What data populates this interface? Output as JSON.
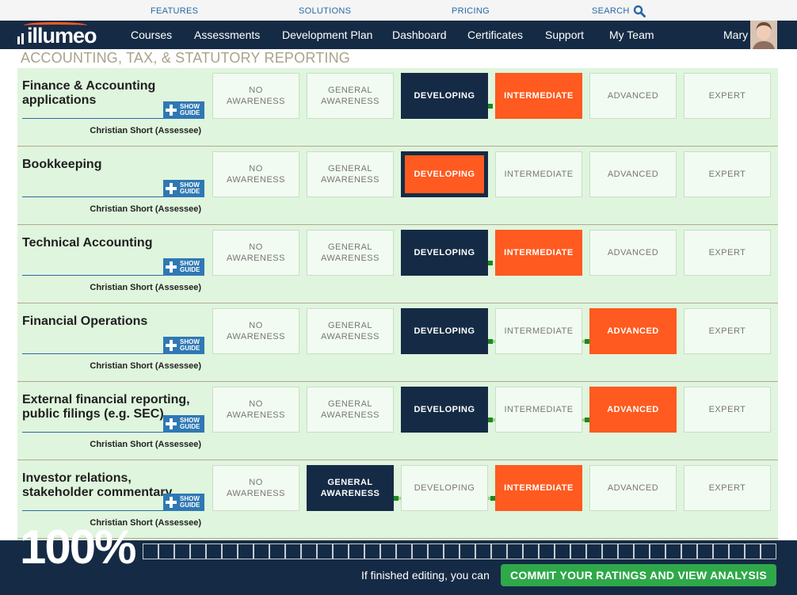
{
  "top_links": {
    "features": "FEATURES",
    "solutions": "SOLUTIONS",
    "pricing": "PRICING",
    "search": "SEARCH"
  },
  "nav": {
    "logo": "illumeo",
    "items": [
      "Courses",
      "Assessments",
      "Development Plan",
      "Dashboard",
      "Certificates",
      "Support",
      "My Team"
    ],
    "user": "Mary"
  },
  "section_title": "ACCOUNTING, TAX, & STATUTORY REPORTING",
  "level_labels": [
    "NO AWARENESS",
    "GENERAL AWARENESS",
    "DEVELOPING",
    "INTERMEDIATE",
    "ADVANCED",
    "EXPERT"
  ],
  "guide_label": {
    "line1": "SHOW",
    "line2": "GUIDE"
  },
  "skills": [
    {
      "name": "Finance & Accounting applications",
      "assessee": "Christian Short (Assessee)",
      "current": 2,
      "target": 3
    },
    {
      "name": "Bookkeeping",
      "assessee": "Christian Short (Assessee)",
      "current": 2,
      "target": 2
    },
    {
      "name": "Technical Accounting",
      "assessee": "Christian Short (Assessee)",
      "current": 2,
      "target": 3
    },
    {
      "name": "Financial Operations",
      "assessee": "Christian Short (Assessee)",
      "current": 2,
      "target": 4
    },
    {
      "name": "External financial reporting, public filings (e.g. SEC)",
      "assessee": "Christian Short (Assessee)",
      "current": 2,
      "target": 4
    },
    {
      "name": "Investor relations, stakeholder commentary",
      "assessee": "Christian Short (Assessee)",
      "current": 1,
      "target": 3
    }
  ],
  "progress": {
    "percent": "100%",
    "value": 100
  },
  "footer": {
    "commit_prompt": "If finished editing, you can",
    "commit_button": "COMMIT YOUR RATINGS AND VIEW ANALYSIS"
  },
  "colors": {
    "navy": "#152b45",
    "orange": "#ff5a1f",
    "green": "#2fa84a",
    "panel": "#dff5dd"
  }
}
